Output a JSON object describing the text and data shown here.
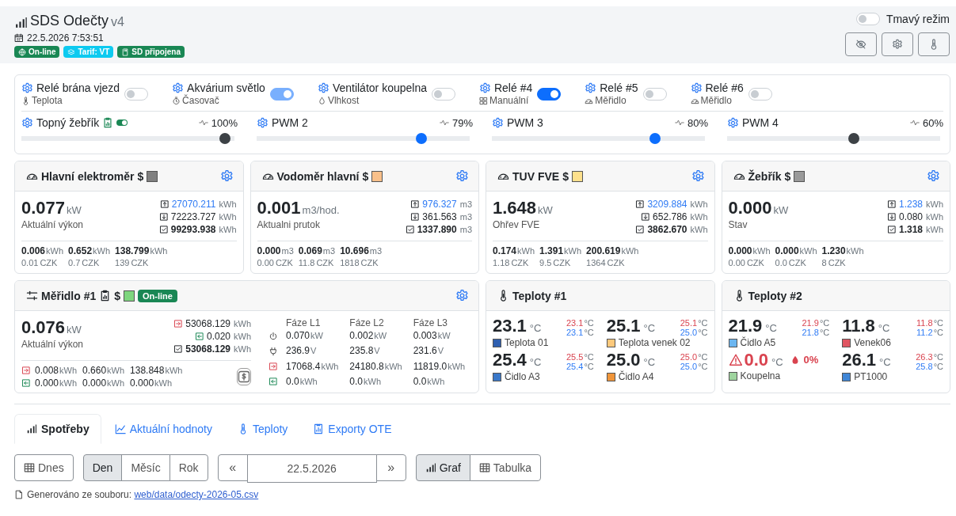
{
  "header": {
    "title": "SDS Odečty",
    "version": "v4",
    "datetime": "22.5.2026 7:53:51",
    "badges": [
      {
        "label": "On-line",
        "kind": "globe",
        "color": "#198754"
      },
      {
        "label": "Tarif: VT",
        "kind": "layers",
        "color": "#0dcaf0"
      },
      {
        "label": "SD připojena",
        "kind": "sd",
        "color": "#198754"
      }
    ],
    "dark_mode": {
      "label": "Tmavý režim",
      "on": false
    }
  },
  "relays": [
    {
      "name": "Relé brána vjezd",
      "source": "Teplota",
      "kind": "thermo",
      "on": false,
      "disabled": false
    },
    {
      "name": "Akvárium světlo",
      "source": "Časovač",
      "kind": "timer",
      "on": true,
      "disabled": true
    },
    {
      "name": "Ventilátor koupelna",
      "source": "Vlhkost",
      "kind": "humidity",
      "on": false,
      "disabled": false
    },
    {
      "name": "Relé #4",
      "source": "Manuální",
      "kind": "manual",
      "on": true,
      "disabled": false
    },
    {
      "name": "Relé #5",
      "source": "Měřidlo",
      "kind": "gauge",
      "on": false,
      "disabled": false
    },
    {
      "name": "Relé #6",
      "source": "Měřidlo",
      "kind": "gauge",
      "on": false,
      "disabled": false
    }
  ],
  "pwm": [
    {
      "name": "Topný žebřík",
      "auto": true,
      "level": 0.98,
      "reading": "100%",
      "disabled": true
    },
    {
      "name": "PWM 2",
      "auto": false,
      "level": 0.79,
      "reading": "79%",
      "disabled": false
    },
    {
      "name": "PWM 3",
      "auto": false,
      "level": 0.78,
      "reading": "80%",
      "disabled": false
    },
    {
      "name": "PWM 4",
      "auto": false,
      "level": 0.6,
      "reading": "60%",
      "disabled": true
    }
  ],
  "meters": [
    {
      "title": "Hlavní elektroměr",
      "currency_mark": "$",
      "color": "#808080",
      "power": "0.077",
      "power_unit": "kW",
      "caption": "Aktuální výkon",
      "import": {
        "value": "27070.211",
        "unit": "kWh"
      },
      "export": {
        "value": "72223.727",
        "unit": "kWh"
      },
      "total": {
        "value": "99293.938",
        "unit": "kWh"
      },
      "periods": [
        {
          "value": "0.006",
          "unit": "kWh",
          "cost": "0.01",
          "cost_unit": "CZK"
        },
        {
          "value": "0.652",
          "unit": "kWh",
          "cost": "0.7",
          "cost_unit": "CZK"
        },
        {
          "value": "138.799",
          "unit": "kWh",
          "cost": "139",
          "cost_unit": "CZK"
        }
      ]
    },
    {
      "title": "Vodoměr hlavní",
      "currency_mark": "$",
      "color": "#f9c08a",
      "power": "0.001",
      "power_unit": "m3/hod.",
      "caption": "Aktualni prutok",
      "import": {
        "value": "976.327",
        "unit": "m3"
      },
      "export": {
        "value": "361.563",
        "unit": "m3"
      },
      "total": {
        "value": "1337.890",
        "unit": "m3"
      },
      "periods": [
        {
          "value": "0.000",
          "unit": "m3",
          "cost": "0.00",
          "cost_unit": "CZK"
        },
        {
          "value": "0.069",
          "unit": "m3",
          "cost": "11.8",
          "cost_unit": "CZK"
        },
        {
          "value": "10.696",
          "unit": "m3",
          "cost": "1818",
          "cost_unit": "CZK"
        }
      ]
    },
    {
      "title": "TUV FVE",
      "currency_mark": "$",
      "color": "#fde08c",
      "power": "1.648",
      "power_unit": "kW",
      "caption": "Ohřev FVE",
      "import": {
        "value": "3209.884",
        "unit": "kWh"
      },
      "export": {
        "value": "652.786",
        "unit": "kWh"
      },
      "total": {
        "value": "3862.670",
        "unit": "kWh"
      },
      "periods": [
        {
          "value": "0.174",
          "unit": "kWh",
          "cost": "1.18",
          "cost_unit": "CZK"
        },
        {
          "value": "1.391",
          "unit": "kWh",
          "cost": "9.5",
          "cost_unit": "CZK"
        },
        {
          "value": "200.619",
          "unit": "kWh",
          "cost": "1364",
          "cost_unit": "CZK"
        }
      ]
    },
    {
      "title": "Žebřík",
      "currency_mark": "$",
      "color": "#9a9a9a",
      "power": "0.000",
      "power_unit": "kW",
      "caption": "Stav",
      "import": {
        "value": "1.238",
        "unit": "kWh"
      },
      "export": {
        "value": "0.080",
        "unit": "kWh"
      },
      "total": {
        "value": "1.318",
        "unit": "kWh"
      },
      "periods": [
        {
          "value": "0.000",
          "unit": "kWh",
          "cost": "0.00",
          "cost_unit": "CZK"
        },
        {
          "value": "0.000",
          "unit": "kWh",
          "cost": "0.0",
          "cost_unit": "CZK"
        },
        {
          "value": "1.230",
          "unit": "kWh",
          "cost": "8",
          "cost_unit": "CZK"
        }
      ]
    }
  ],
  "gauge": {
    "title": "Měřidlo #1",
    "currency_mark": "$",
    "color": "#7ed67e",
    "status": "On-line",
    "power": "0.076",
    "power_unit": "kW",
    "caption": "Aktuální výkon",
    "import": {
      "value": "53068.129",
      "unit": "kWh"
    },
    "export": {
      "value": "0.020",
      "unit": "kWh"
    },
    "total": {
      "value": "53068.129",
      "unit": "kWh"
    },
    "import_periods": [
      {
        "value": "0.008",
        "unit": "kWh"
      },
      {
        "value": "0.660",
        "unit": "kWh"
      },
      {
        "value": "138.848",
        "unit": "kWh"
      }
    ],
    "export_periods": [
      {
        "value": "0.000",
        "unit": "kWh"
      },
      {
        "value": "0.000",
        "unit": "kWh"
      },
      {
        "value": "0.000",
        "unit": "kWh"
      }
    ],
    "phase_headers": [
      "Fáze L1",
      "Fáze L2",
      "Fáze L3"
    ],
    "phase_rows": [
      {
        "kind": "power",
        "values": [
          {
            "value": "0.070",
            "unit": "kW"
          },
          {
            "value": "0.002",
            "unit": "kW"
          },
          {
            "value": "0.003",
            "unit": "kW"
          }
        ]
      },
      {
        "kind": "voltage",
        "values": [
          {
            "value": "236.9",
            "unit": "V"
          },
          {
            "value": "235.8",
            "unit": "V"
          },
          {
            "value": "231.6",
            "unit": "V"
          }
        ]
      },
      {
        "kind": "import",
        "values": [
          {
            "value": "17068.4",
            "unit": "kWh"
          },
          {
            "value": "24180.8",
            "unit": "kWh"
          },
          {
            "value": "11819.0",
            "unit": "kWh"
          }
        ]
      },
      {
        "kind": "export",
        "values": [
          {
            "value": "0.0",
            "unit": "kWh"
          },
          {
            "value": "0.0",
            "unit": "kWh"
          },
          {
            "value": "0.0",
            "unit": "kWh"
          }
        ]
      }
    ]
  },
  "temperatures": [
    {
      "title": "Teploty #1",
      "sensors": [
        {
          "name": "Teplota 01",
          "value": "23.1",
          "unit": "°C",
          "color": "#2f5fb0",
          "max": "23.1",
          "max_unit": "°C",
          "min": "23.1",
          "min_unit": "°C",
          "alarm": false
        },
        {
          "name": "Teplota venek 02",
          "value": "25.1",
          "unit": "°C",
          "color": "#fdc97c",
          "max": "25.1",
          "max_unit": "°C",
          "min": "25.0",
          "min_unit": "°C",
          "alarm": false
        },
        {
          "name": "Čidlo A3",
          "value": "25.4",
          "unit": "°C",
          "color": "#3a78c9",
          "max": "25.5",
          "max_unit": "°C",
          "min": "25.4",
          "min_unit": "°C",
          "alarm": false
        },
        {
          "name": "Čidlo A4",
          "value": "25.0",
          "unit": "°C",
          "color": "#f0953a",
          "max": "25.0",
          "max_unit": "°C",
          "min": "25.0",
          "min_unit": "°C",
          "alarm": false
        }
      ]
    },
    {
      "title": "Teploty #2",
      "sensors": [
        {
          "name": "Čidlo A5",
          "value": "21.9",
          "unit": "°C",
          "color": "#6cb6f0",
          "max": "21.9",
          "max_unit": "°C",
          "min": "21.8",
          "min_unit": "°C",
          "alarm": false
        },
        {
          "name": "Venek06",
          "value": "11.8",
          "unit": "°C",
          "color": "#e05562",
          "max": "11.8",
          "max_unit": "°C",
          "min": "11.2",
          "min_unit": "°C",
          "alarm": false
        },
        {
          "name": "Koupelna",
          "value": "0.0",
          "unit": "°C",
          "color": "#9fd49f",
          "alarm": true,
          "humidity": "0%"
        },
        {
          "name": "PT1000",
          "value": "26.1",
          "unit": "°C",
          "color": "#3f86d6",
          "max": "26.3",
          "max_unit": "°C",
          "min": "25.8",
          "min_unit": "°C",
          "alarm": false
        }
      ]
    }
  ],
  "tabs": [
    {
      "label": "Spotřeby",
      "kind": "bars",
      "selected": true
    },
    {
      "label": "Aktuální hodnoty",
      "kind": "line",
      "selected": false
    },
    {
      "label": "Teploty",
      "kind": "thermo",
      "selected": false
    },
    {
      "label": "Exporty OTE",
      "kind": "report",
      "selected": false
    }
  ],
  "today_button": "Dnes",
  "periods": [
    {
      "label": "Den",
      "selected": true
    },
    {
      "label": "Měsíc",
      "selected": false
    },
    {
      "label": "Rok",
      "selected": false
    }
  ],
  "date_nav": {
    "prev": "«",
    "date": "22.5.2026",
    "next": "»"
  },
  "views": [
    {
      "label": "Graf",
      "kind": "bars",
      "selected": true
    },
    {
      "label": "Tabulka",
      "kind": "table",
      "selected": false
    }
  ],
  "source": {
    "text": "Generováno ze souboru: ",
    "link": "web/data/odecty-2026-05.csv"
  }
}
